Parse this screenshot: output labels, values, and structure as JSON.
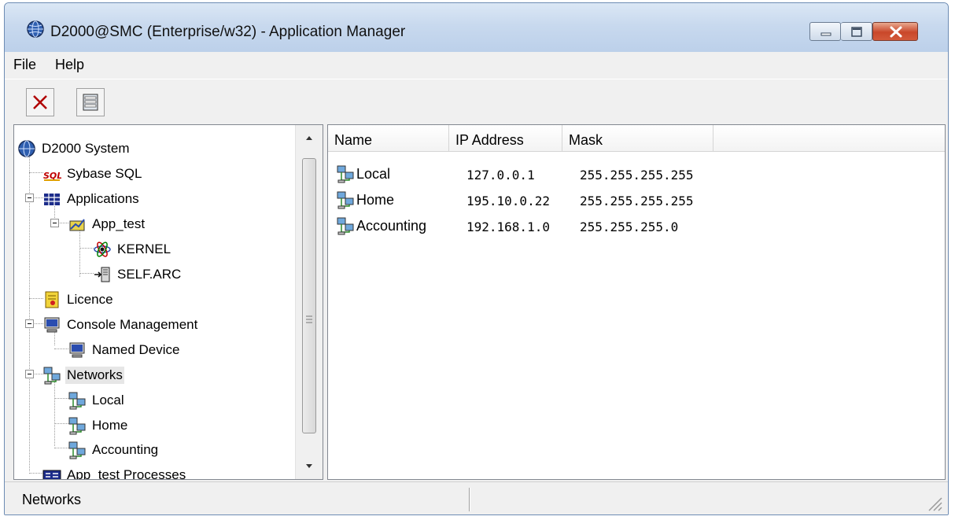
{
  "window": {
    "title": "D2000@SMC (Enterprise/w32) - Application Manager",
    "accent": "#c9472a"
  },
  "menu": [
    "File",
    "Help"
  ],
  "toolbar": {
    "buttons": [
      {
        "icon": "delete-x-icon"
      },
      {
        "icon": "properties-icon"
      }
    ]
  },
  "tree": {
    "items": [
      {
        "label": "D2000 System",
        "icon": "globe-icon"
      },
      {
        "label": "Sybase SQL",
        "icon": "sql-icon"
      },
      {
        "label": "Applications",
        "icon": "applications-grid-icon"
      },
      {
        "label": "App_test",
        "icon": "app-icon"
      },
      {
        "label": "KERNEL",
        "icon": "kernel-atom-icon"
      },
      {
        "label": "SELF.ARC",
        "icon": "archive-icon"
      },
      {
        "label": "Licence",
        "icon": "licence-icon"
      },
      {
        "label": "Console Management",
        "icon": "computer-icon"
      },
      {
        "label": "Named Device",
        "icon": "computer-icon"
      },
      {
        "label": "Networks",
        "icon": "network-icon",
        "selected": true
      },
      {
        "label": "Local",
        "icon": "network-icon"
      },
      {
        "label": "Home",
        "icon": "network-icon"
      },
      {
        "label": "Accounting",
        "icon": "network-icon"
      },
      {
        "label": "App_test Processes",
        "icon": "processes-icon"
      }
    ]
  },
  "list": {
    "columns": [
      "Name",
      "IP Address",
      "Mask"
    ],
    "rows": [
      {
        "name": "Local",
        "ip": "127.0.0.1",
        "mask": "255.255.255.255"
      },
      {
        "name": "Home",
        "ip": "195.10.0.22",
        "mask": "255.255.255.255"
      },
      {
        "name": "Accounting",
        "ip": "192.168.1.0",
        "mask": "255.255.255.0"
      }
    ]
  },
  "status": {
    "text": "Networks"
  }
}
